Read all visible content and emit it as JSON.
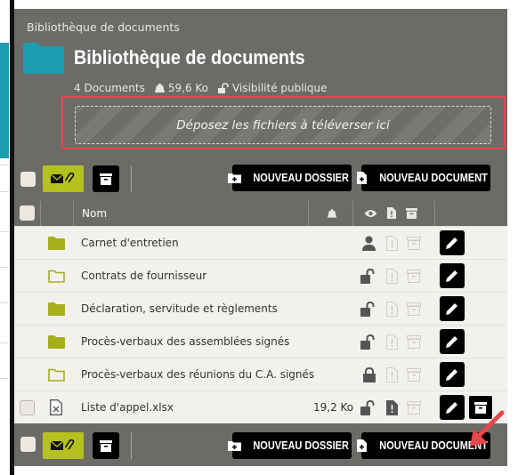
{
  "breadcrumb": "Bibliothèque de documents",
  "title": "Bibliothèque de documents",
  "meta": {
    "documents": "4 Documents",
    "size": "59,6 Ko",
    "visibility": "Visibilité publique"
  },
  "dropzone": {
    "text": "Déposez les fichiers à téléverser ici"
  },
  "toolbar": {
    "new_folder": "NOUVEAU DOSSIER",
    "new_document": "NOUVEAU DOCUMENT"
  },
  "table": {
    "header_name": "Nom",
    "rows": [
      {
        "name": "Carnet d'entretien",
        "type": "folder-filled",
        "size": "",
        "access": "user"
      },
      {
        "name": "Contrats de fournisseur",
        "type": "folder-outline",
        "size": "",
        "access": "unlocked"
      },
      {
        "name": "Déclaration, servitude et règlements",
        "type": "folder-filled",
        "size": "",
        "access": "unlocked"
      },
      {
        "name": "Procès-verbaux des assemblées signés",
        "type": "folder-filled",
        "size": "",
        "access": "unlocked"
      },
      {
        "name": "Procès-verbaux des réunions du C.A. signés",
        "type": "folder-outline",
        "size": "",
        "access": "locked"
      },
      {
        "name": "Liste d'appel.xlsx",
        "type": "file-excel",
        "size": "19,2 Ko",
        "access": "unlocked"
      }
    ]
  },
  "colors": {
    "panel": "#6d6b68",
    "accent_green": "#b5c21e",
    "folder_green": "#a6b01a",
    "folder_teal": "#1f9db0",
    "highlight_red": "#e5474b"
  }
}
